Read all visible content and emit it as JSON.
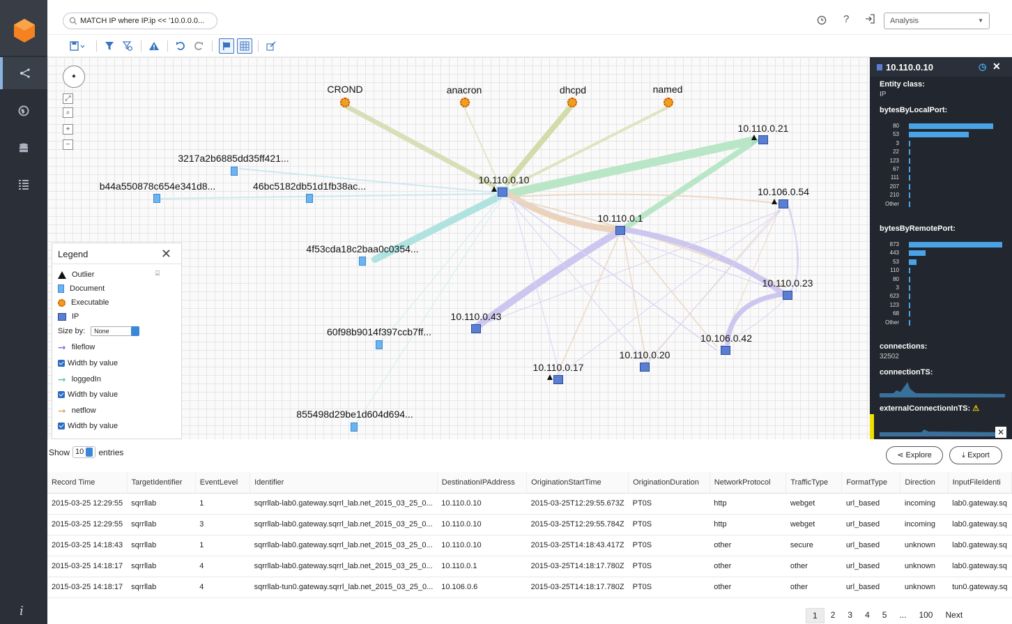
{
  "search": {
    "query": "MATCH IP  where IP.ip << '10.0.0.0..."
  },
  "header": {
    "mode_select": "Analysis"
  },
  "graph": {
    "nodes": {
      "crond": "CROND",
      "anacron": "anacron",
      "dhcpd": "dhcpd",
      "named": "named",
      "ip_10_110_0_21": "10.110.0.21",
      "ip_10_110_0_10": "10.110.0.10",
      "ip_10_106_0_54": "10.106.0.54",
      "ip_10_110_0_1": "10.110.0.1",
      "ip_10_110_0_23": "10.110.0.23",
      "ip_10_110_0_43": "10.110.0.43",
      "ip_10_106_0_42": "10.106.0.42",
      "ip_10_110_0_20": "10.110.0.20",
      "ip_10_110_0_17": "10.110.0.17",
      "doc_3217": "3217a2b6885dd35ff421...",
      "doc_b44a": "b44a550878c654e341d8...",
      "doc_46bc": "46bc5182db51d1fb38ac...",
      "doc_4f53": "4f53cda18c2baa0c0354...",
      "doc_60f9": "60f98b9014f397ccb7ff...",
      "doc_8554": "855498d29be1d604d694..."
    }
  },
  "legend": {
    "title": "Legend",
    "items": {
      "outlier": "Outlier",
      "document": "Document",
      "executable": "Executable",
      "ip": "IP"
    },
    "size_by_label": "Size by:",
    "size_by_value": "None",
    "flows": [
      {
        "label": "fileflow",
        "color": "#7b6fd6",
        "width_label": "Width by value"
      },
      {
        "label": "loggedIn",
        "color": "#5cc78a",
        "width_label": "Width by value"
      },
      {
        "label": "netflow",
        "color": "#e0a060",
        "width_label": "Width by value"
      }
    ]
  },
  "details": {
    "title": "10.110.0.10",
    "entity_class_label": "Entity class:",
    "entity_class_value": "IP",
    "local_port_label": "bytesByLocalPort:",
    "local_ports": [
      {
        "label": "80",
        "value": 0.9
      },
      {
        "label": "53",
        "value": 0.64
      },
      {
        "label": "3",
        "value": 0.01
      },
      {
        "label": "22",
        "value": 0.01
      },
      {
        "label": "123",
        "value": 0.01
      },
      {
        "label": "67",
        "value": 0.01
      },
      {
        "label": "111",
        "value": 0.01
      },
      {
        "label": "207",
        "value": 0.01
      },
      {
        "label": "210",
        "value": 0.01
      },
      {
        "label": "Other",
        "value": 0.01
      }
    ],
    "remote_port_label": "bytesByRemotePort:",
    "remote_ports": [
      {
        "label": "873",
        "value": 1.0
      },
      {
        "label": "443",
        "value": 0.18
      },
      {
        "label": "53",
        "value": 0.08
      },
      {
        "label": "110",
        "value": 0.01
      },
      {
        "label": "80",
        "value": 0.01
      },
      {
        "label": "3",
        "value": 0.01
      },
      {
        "label": "623",
        "value": 0.01
      },
      {
        "label": "123",
        "value": 0.01
      },
      {
        "label": "68",
        "value": 0.01
      },
      {
        "label": "Other",
        "value": 0.01
      }
    ],
    "connections_label": "connections:",
    "connections_value": "32502",
    "connection_ts_label": "connectionTS:",
    "external_ts_label": "externalConnectionInTS:"
  },
  "table": {
    "show_label": "Show",
    "entries_count": "10",
    "entries_label": "entries",
    "explore_label": "Explore",
    "export_label": "Export",
    "columns": [
      "Record Time",
      "TargetIdentifier",
      "EventLevel",
      "Identifier",
      "DestinationIPAddress",
      "OriginationStartTime",
      "OriginationDuration",
      "NetworkProtocol",
      "TrafficType",
      "FormatType",
      "Direction",
      "InputFileIdenti"
    ],
    "rows": [
      [
        "2015-03-25 12:29:55",
        "sqrrllab",
        "1",
        "sqrrllab-lab0.gateway.sqrrl_lab.net_2015_03_25_0...",
        "10.110.0.10",
        "2015-03-25T12:29:55.673Z",
        "PT0S",
        "http",
        "webget",
        "url_based",
        "incoming",
        "lab0.gateway.sq"
      ],
      [
        "2015-03-25 12:29:55",
        "sqrrllab",
        "3",
        "sqrrllab-lab0.gateway.sqrrl_lab.net_2015_03_25_0...",
        "10.110.0.10",
        "2015-03-25T12:29:55.784Z",
        "PT0S",
        "http",
        "webget",
        "url_based",
        "incoming",
        "lab0.gateway.sq"
      ],
      [
        "2015-03-25 14:18:43",
        "sqrrllab",
        "1",
        "sqrrllab-lab0.gateway.sqrrl_lab.net_2015_03_25_0...",
        "10.110.0.10",
        "2015-03-25T14:18:43.417Z",
        "PT0S",
        "other",
        "secure",
        "url_based",
        "unknown",
        "lab0.gateway.sq"
      ],
      [
        "2015-03-25 14:18:17",
        "sqrrllab",
        "4",
        "sqrrllab-lab0.gateway.sqrrl_lab.net_2015_03_25_0...",
        "10.110.0.1",
        "2015-03-25T14:18:17.780Z",
        "PT0S",
        "other",
        "other",
        "url_based",
        "unknown",
        "lab0.gateway.sq"
      ],
      [
        "2015-03-25 14:18:17",
        "sqrrllab",
        "4",
        "sqrrllab-tun0.gateway.sqrrl_lab.net_2015_03_25_0...",
        "10.106.0.6",
        "2015-03-25T14:18:17.780Z",
        "PT0S",
        "other",
        "other",
        "url_based",
        "unknown",
        "tun0.gateway.sq"
      ]
    ],
    "pages": [
      "1",
      "2",
      "3",
      "4",
      "5",
      "...",
      "100",
      "Next"
    ]
  }
}
